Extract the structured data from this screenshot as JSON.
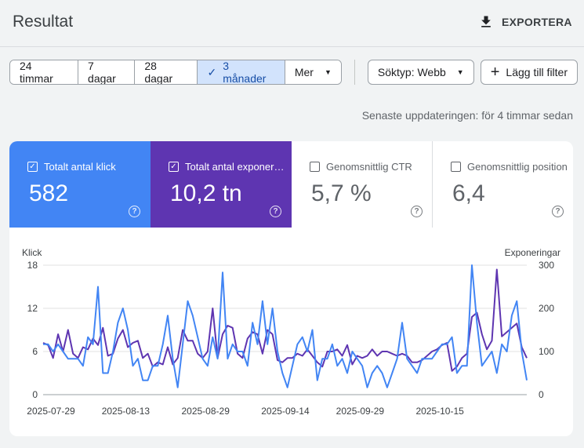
{
  "header": {
    "title": "Resultat",
    "export_label": "EXPORTERA"
  },
  "filters": {
    "ranges": [
      {
        "label": "24 timmar",
        "selected": false
      },
      {
        "label": "7 dagar",
        "selected": false
      },
      {
        "label": "28 dagar",
        "selected": false
      },
      {
        "label": "3 månader",
        "selected": true
      },
      {
        "label": "Mer",
        "selected": false
      }
    ],
    "search_type": "Söktyp: Webb",
    "add_filter": "Lägg till filter"
  },
  "updated_text": "Senaste uppdateringen: för 4 timmar sedan",
  "metrics": [
    {
      "label": "Totalt antal klick",
      "value": "582",
      "checked": true,
      "color": "#4285f4"
    },
    {
      "label": "Totalt antal exponeringar",
      "value": "10,2 tn",
      "checked": true,
      "color": "#5e35b1"
    },
    {
      "label": "Genomsnittlig CTR",
      "value": "5,7 %",
      "checked": false
    },
    {
      "label": "Genomsnittlig position",
      "value": "6,4",
      "checked": false
    }
  ],
  "icons": {
    "export": "download-icon",
    "check": "check-icon",
    "caret": "caret-down-icon",
    "plus": "plus-icon",
    "help": "help-circle-icon"
  },
  "chart_data": {
    "type": "line",
    "left_axis": {
      "title": "Klick",
      "ticks": [
        0,
        6,
        12,
        18
      ],
      "range": [
        0,
        18
      ]
    },
    "right_axis": {
      "title": "Exponeringar",
      "ticks": [
        0,
        100,
        200,
        300
      ],
      "range": [
        0,
        300
      ]
    },
    "x_tick_labels": [
      "2025-07-29",
      "2025-08-13",
      "2025-08-29",
      "2025-09-14",
      "2025-09-29",
      "2025-10-15"
    ],
    "x_tick_indices": [
      0,
      15,
      31,
      47,
      62,
      78
    ],
    "series": [
      {
        "name": "Totalt antal klick",
        "axis": "left",
        "color": "#4285f4",
        "values": [
          7,
          7,
          6,
          7,
          6,
          5,
          5,
          5,
          4,
          8,
          7,
          15,
          3,
          3,
          6,
          10,
          12,
          9,
          4,
          5,
          2,
          2,
          4,
          4,
          7,
          11,
          5,
          1,
          7,
          13,
          11,
          8,
          5,
          4,
          8,
          5,
          17,
          5,
          7,
          6,
          6,
          4,
          10,
          7,
          13,
          7,
          12,
          6,
          3,
          1,
          4,
          7,
          8,
          6,
          9,
          2,
          5,
          5,
          7,
          4,
          5,
          3,
          6,
          5,
          4,
          1,
          3,
          4,
          3,
          1,
          3,
          5,
          10,
          5,
          4,
          3,
          5,
          5,
          5,
          6,
          7,
          7,
          8,
          3,
          4,
          4,
          18,
          10,
          4,
          5,
          6,
          3,
          7,
          6,
          11,
          13,
          6,
          2
        ]
      },
      {
        "name": "Totalt antal exponeringar",
        "axis": "right",
        "color": "#5e35b1",
        "values": [
          120,
          115,
          85,
          140,
          100,
          150,
          95,
          85,
          110,
          105,
          130,
          115,
          155,
          90,
          95,
          130,
          150,
          110,
          120,
          125,
          85,
          95,
          65,
          75,
          70,
          110,
          70,
          85,
          150,
          125,
          125,
          95,
          85,
          100,
          200,
          85,
          140,
          160,
          155,
          95,
          85,
          130,
          145,
          140,
          95,
          150,
          140,
          80,
          75,
          85,
          85,
          95,
          90,
          105,
          90,
          75,
          65,
          100,
          100,
          105,
          90,
          115,
          70,
          90,
          85,
          90,
          105,
          90,
          100,
          100,
          95,
          90,
          95,
          90,
          75,
          75,
          80,
          90,
          100,
          105,
          115,
          120,
          55,
          65,
          85,
          95,
          180,
          190,
          140,
          105,
          125,
          290,
          135,
          145,
          155,
          165,
          110,
          85
        ]
      }
    ]
  }
}
